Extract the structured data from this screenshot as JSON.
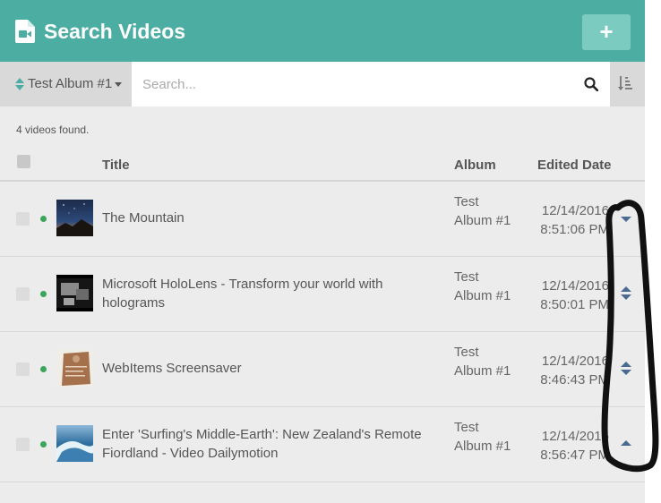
{
  "header": {
    "title": "Search Videos",
    "add_label": "+"
  },
  "toolbar": {
    "album_label": "Test Album #1",
    "search_placeholder": "Search...",
    "search_value": ""
  },
  "results": {
    "count_text": "4 videos found."
  },
  "columns": {
    "title": "Title",
    "album": "Album",
    "edited_date": "Edited Date"
  },
  "videos": [
    {
      "title": "The Mountain",
      "album": "Test Album #1",
      "date": "12/14/2016",
      "time": "8:51:06 PM",
      "status": "published",
      "reorder": "down"
    },
    {
      "title": "Microsoft HoloLens - Transform your world with holograms",
      "album": "Test Album #1",
      "date": "12/14/2016",
      "time": "8:50:01 PM",
      "status": "published",
      "reorder": "up-down"
    },
    {
      "title": "WebItems Screensaver",
      "album": "Test Album #1",
      "date": "12/14/2016",
      "time": "8:46:43 PM",
      "status": "published",
      "reorder": "up-down"
    },
    {
      "title": "Enter 'Surfing's Middle-Earth': New Zealand's Remote Fiordland - Video Dailymotion",
      "album": "Test Album #1",
      "date": "12/14/2016",
      "time": "8:56:47 PM",
      "status": "published",
      "reorder": "up"
    }
  ],
  "colors": {
    "header": "#4cada3",
    "status_dot": "#3ba55c",
    "arrow": "#4a6a8f"
  }
}
